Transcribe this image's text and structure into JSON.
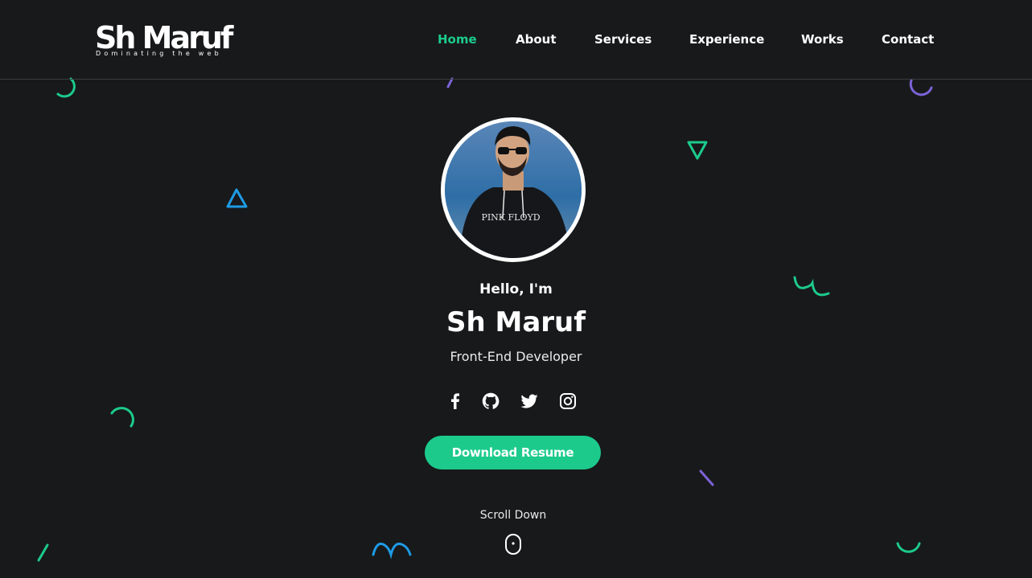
{
  "header": {
    "logo": {
      "title": "Sh Maruf",
      "tagline": "Dominating the web"
    },
    "nav": [
      {
        "label": "Home",
        "active": true
      },
      {
        "label": "About",
        "active": false
      },
      {
        "label": "Services",
        "active": false
      },
      {
        "label": "Experience",
        "active": false
      },
      {
        "label": "Works",
        "active": false
      },
      {
        "label": "Contact",
        "active": false
      }
    ]
  },
  "hero": {
    "greeting": "Hello, I'm",
    "name": "Sh Maruf",
    "role": "Front-End Developer",
    "profile_photo": {
      "shirt_text": "PINK FLOYD"
    },
    "social_icons": [
      "facebook-icon",
      "github-icon",
      "twitter-icon",
      "instagram-icon"
    ],
    "cta_label": "Download Resume",
    "scroll_label": "Scroll Down"
  },
  "colors": {
    "background": "#18191b",
    "accent": "#1ccb8c",
    "shape_blue": "#1e9be6",
    "shape_purple": "#7c63d6",
    "text": "#ffffff"
  }
}
